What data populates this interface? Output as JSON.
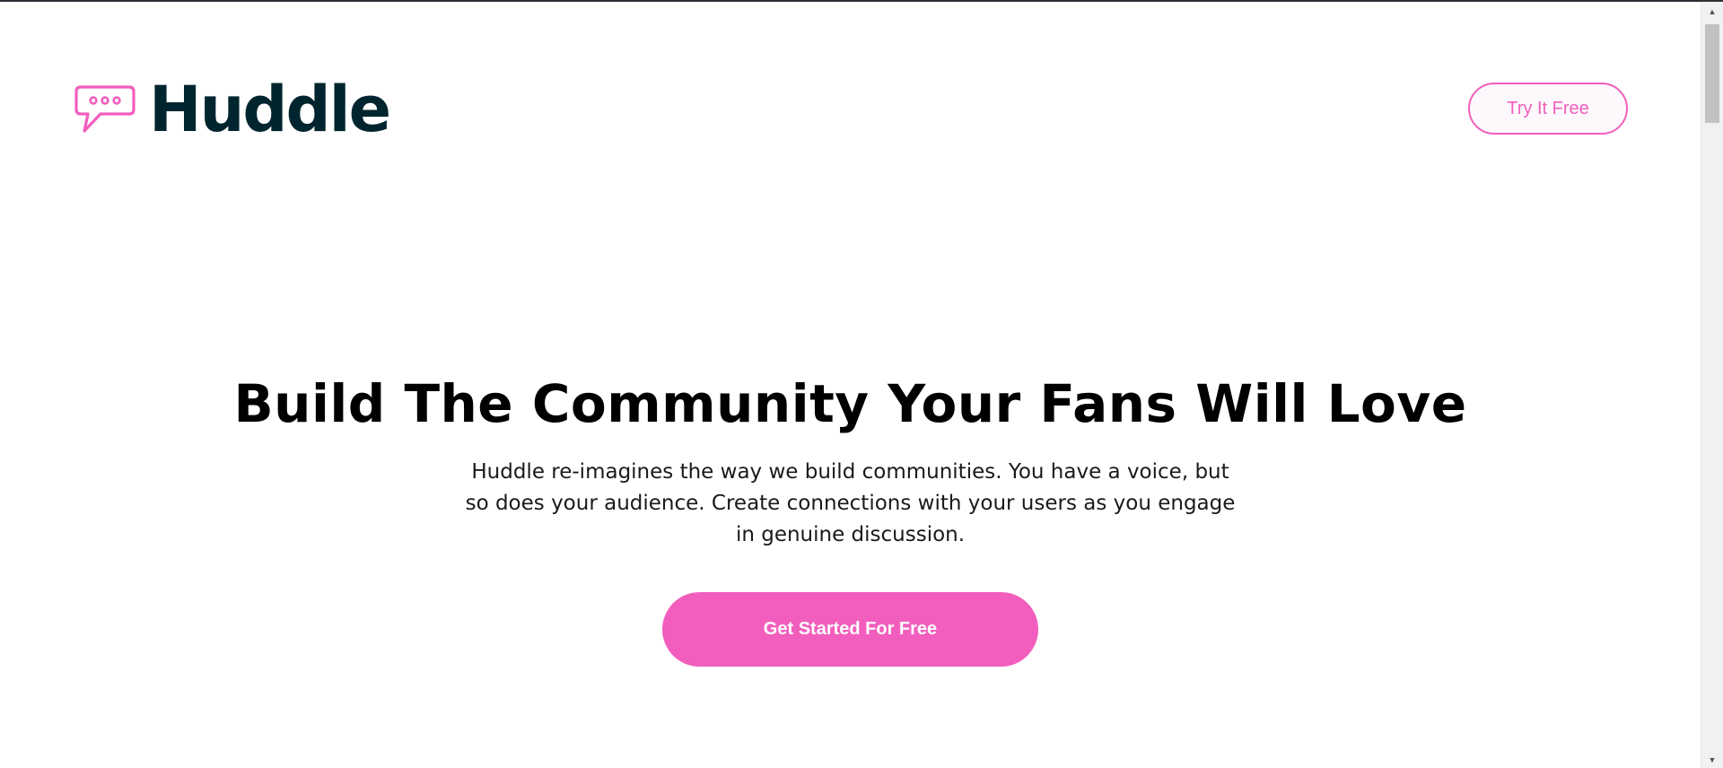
{
  "brand": {
    "name": "Huddle",
    "accent_color": "#f25ebd",
    "text_color": "#00252e"
  },
  "header": {
    "logo_icon": "chat-bubble-icon",
    "cta_label": "Try It Free"
  },
  "hero": {
    "title": "Build The Community Your Fans Will Love",
    "description": "Huddle re-imagines the way we build communities. You have a voice, but so does your audience. Create connections with your users as you engage in genuine discussion.",
    "cta_label": "Get Started For Free"
  },
  "scrollbar": {
    "up_icon": "scroll-up-arrow-icon",
    "down_icon": "scroll-down-arrow-icon"
  }
}
